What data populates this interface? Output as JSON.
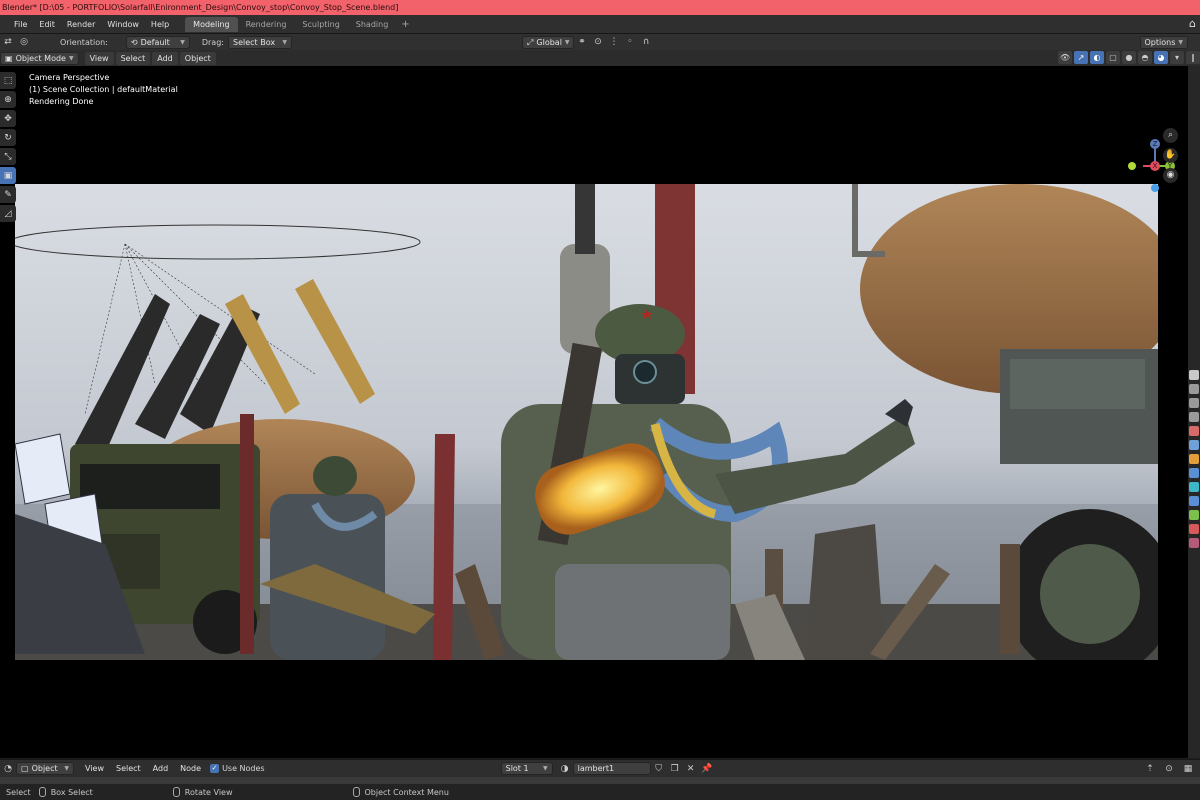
{
  "window": {
    "title": "Blender* [D:\\05 - PORTFOLIO\\Solarfall\\Enironment_Design\\Convoy_stop\\Convoy_Stop_Scene.blend]"
  },
  "menu": [
    "File",
    "Edit",
    "Render",
    "Window",
    "Help"
  ],
  "workspaces": [
    "Modeling",
    "Rendering",
    "Sculpting",
    "Shading"
  ],
  "workspace_active": "Modeling",
  "workspace_add": "+",
  "tool_settings": {
    "orientation_label": "Orientation:",
    "orientation_value": "Default",
    "drag_label": "Drag:",
    "drag_value": "Select Box",
    "transform_orientation": "Global",
    "options": "Options"
  },
  "viewport_header": {
    "mode": "Object Mode",
    "menus": [
      "View",
      "Select",
      "Add",
      "Object"
    ]
  },
  "overlay": {
    "line1": "Camera Perspective",
    "line2": "(1) Scene Collection | defaultMaterial",
    "line3": "Rendering Done"
  },
  "gizmo": {
    "z": "Z",
    "x": "X",
    "y": "Y"
  },
  "node_header": {
    "editor": "Object",
    "menus": [
      "View",
      "Select",
      "Add",
      "Node"
    ],
    "use_nodes": "Use Nodes",
    "slot": "Slot 1",
    "material": "lambert1"
  },
  "status_bar": {
    "select": "Select",
    "box_select": "Box Select",
    "rotate_view": "Rotate View",
    "context_menu": "Object Context Menu"
  },
  "colors": {
    "title_bar": "#f1626a",
    "accent": "#4772b3",
    "viewport_bg": "#000000"
  }
}
